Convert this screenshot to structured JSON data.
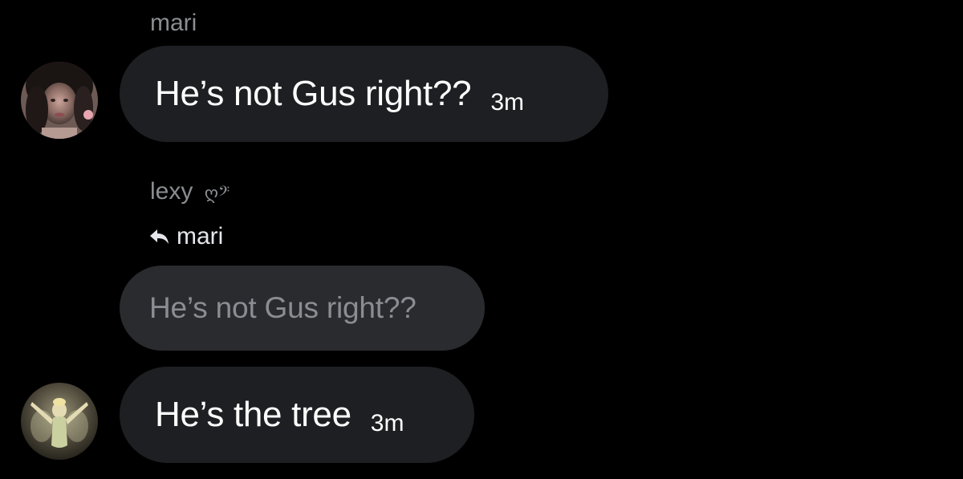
{
  "messages": [
    {
      "sender": "mari",
      "text": "He’s not Gus right??",
      "time": "3m"
    },
    {
      "sender": "lexy",
      "sender_emoji": "ღ𝄢",
      "reply_to": "mari",
      "quoted_text": "He’s not Gus right??",
      "text": "He’s the tree",
      "time": "3m"
    }
  ],
  "icons": {
    "reply": "reply-arrow-icon"
  },
  "colors": {
    "background": "#000000",
    "bubble": "#1e1f22",
    "quoted_bubble": "#2a2b2e",
    "muted_text": "#8a8d91",
    "text": "#ffffff"
  }
}
